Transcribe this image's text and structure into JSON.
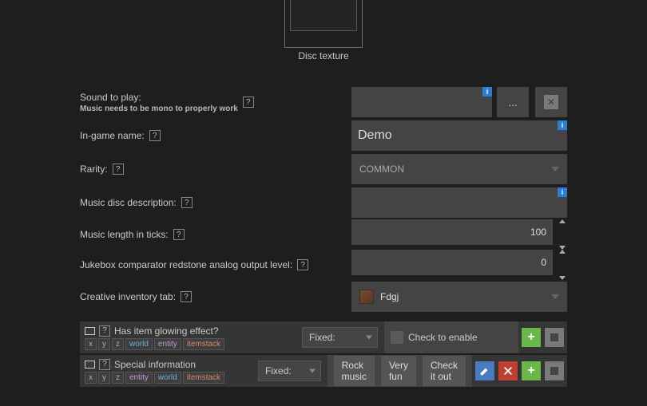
{
  "texture": {
    "label": "Disc texture"
  },
  "info_badge": "i",
  "fields": {
    "sound": {
      "label": "Sound to play:",
      "sublabel": "Music needs to be mono to properly work",
      "browse": "...",
      "value": ""
    },
    "name": {
      "label": "In-game name:",
      "value": "Demo"
    },
    "rarity": {
      "label": "Rarity:",
      "value": "COMMON"
    },
    "desc": {
      "label": "Music disc description:",
      "value": ""
    },
    "length": {
      "label": "Music length in ticks:",
      "value": "100"
    },
    "jukebox": {
      "label": "Jukebox comparator redstone analog output level:",
      "value": "0"
    },
    "tab": {
      "label": "Creative inventory tab:",
      "value": "Fdgj"
    }
  },
  "glowing": {
    "label": "Has item glowing effect?",
    "mode": "Fixed:",
    "check_label": "Check to enable",
    "tags": [
      "x",
      "y",
      "z",
      "world",
      "entity",
      "itemstack"
    ]
  },
  "special": {
    "label": "Special information",
    "mode": "Fixed:",
    "chips": [
      "Rock music",
      "Very fun",
      "Check it out"
    ],
    "tags": [
      "x",
      "y",
      "z",
      "entity",
      "world",
      "itemstack"
    ]
  }
}
